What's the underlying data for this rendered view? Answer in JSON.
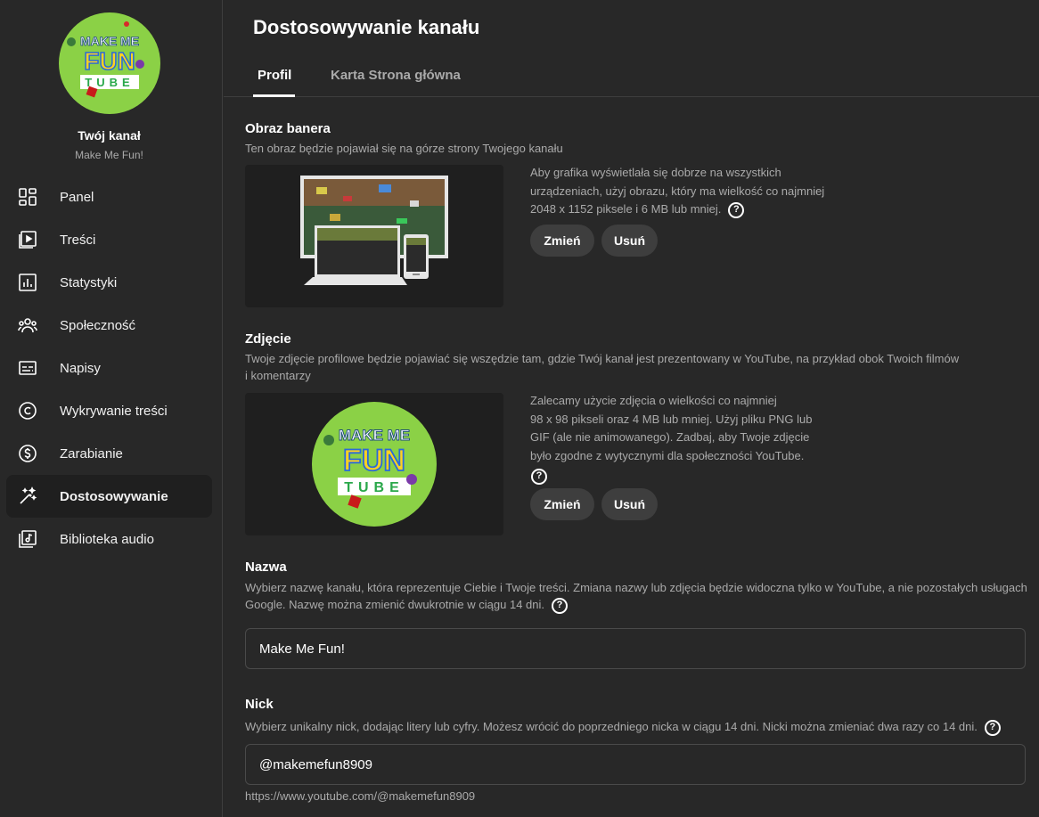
{
  "sidebar": {
    "channel_title": "Twój kanał",
    "channel_name": "Make Me Fun!",
    "logo": {
      "line1": "MAKE ME",
      "line2": "FUN",
      "line3": "TUBE"
    },
    "items": [
      {
        "label": "Panel",
        "icon": "dashboard-icon"
      },
      {
        "label": "Treści",
        "icon": "content-icon"
      },
      {
        "label": "Statystyki",
        "icon": "analytics-icon"
      },
      {
        "label": "Społeczność",
        "icon": "community-icon"
      },
      {
        "label": "Napisy",
        "icon": "subtitles-icon"
      },
      {
        "label": "Wykrywanie treści",
        "icon": "copyright-icon"
      },
      {
        "label": "Zarabianie",
        "icon": "monetization-icon"
      },
      {
        "label": "Dostosowywanie",
        "icon": "customization-icon",
        "active": true
      },
      {
        "label": "Biblioteka audio",
        "icon": "audio-library-icon"
      }
    ]
  },
  "header": {
    "title": "Dostosowywanie kanału",
    "tabs": [
      {
        "label": "Profil",
        "active": true
      },
      {
        "label": "Karta Strona główna"
      }
    ]
  },
  "banner": {
    "title": "Obraz banera",
    "desc": "Ten obraz będzie pojawiał się na górze strony Twojego kanału",
    "info": [
      "Aby grafika wyświetlała się dobrze na wszystkich",
      "urządzeniach, użyj obrazu, który ma wielkość co najmniej",
      "2048 x 1152 piksele i 6 MB lub mniej."
    ],
    "change_label": "Zmień",
    "remove_label": "Usuń"
  },
  "photo": {
    "title": "Zdjęcie",
    "desc": [
      "Twoje zdjęcie profilowe będzie pojawiać się wszędzie tam, gdzie Twój kanał jest prezentowany w YouTube, na przykład obok Twoich filmów",
      "i komentarzy"
    ],
    "info": [
      "Zalecamy użycie zdjęcia o wielkości co najmniej",
      "98 x 98 pikseli oraz 4 MB lub mniej. Użyj pliku PNG lub",
      "GIF (ale nie animowanego). Zadbaj, aby Twoje zdjęcie",
      "było zgodne z wytycznymi dla społeczności YouTube."
    ],
    "change_label": "Zmień",
    "remove_label": "Usuń"
  },
  "name": {
    "title": "Nazwa",
    "desc": [
      "Wybierz nazwę kanału, która reprezentuje Ciebie i Twoje treści. Zmiana nazwy lub zdjęcia będzie widoczna tylko w YouTube, a nie pozostałych usługach",
      "Google. Nazwę można zmienić dwukrotnie w ciągu 14 dni."
    ],
    "value": "Make Me Fun!"
  },
  "handle": {
    "title": "Nick",
    "desc": "Wybierz unikalny nick, dodając litery lub cyfry. Możesz wrócić do poprzedniego nicka w ciągu 14 dni. Nicki można zmieniać dwa razy co 14 dni.",
    "value": "@makemefun8909",
    "url": "https://www.youtube.com/@makemefun8909"
  },
  "colors": {
    "accent": "#ffffff",
    "logo_green": "#8bd146",
    "panel": "#1f1f1f",
    "button": "#3e3e3e"
  }
}
